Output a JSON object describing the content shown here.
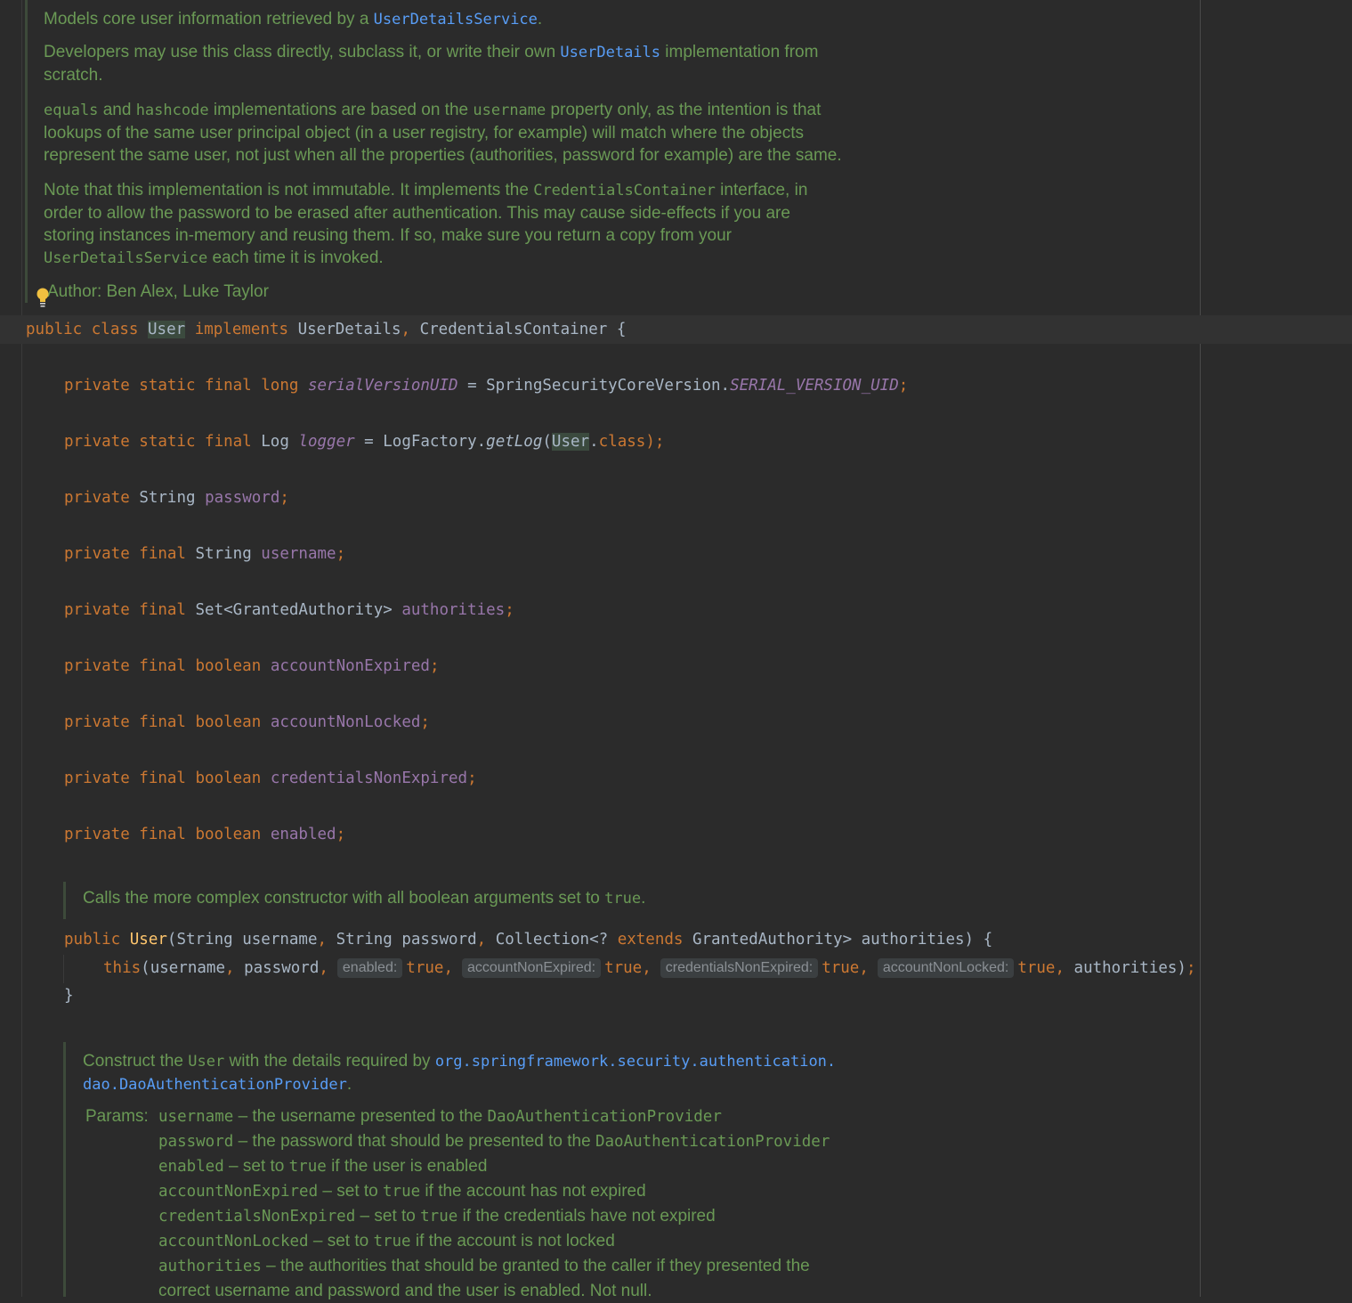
{
  "javadoc_class": {
    "p1_text": "Models core user information retrieved by a ",
    "p1_link": "UserDetailsService",
    "p1_end": ".",
    "p2_a": "Developers may use this class directly, subclass it, or write their own ",
    "p2_link": "UserDetails",
    "p2_b": " implementation from",
    "p2_c": "scratch.",
    "p3_code1": "equals",
    "p3_a": " and ",
    "p3_code2": "hashcode",
    "p3_b": " implementations are based on the ",
    "p3_code3": "username",
    "p3_c": " property only, as the intention is that",
    "p3_line2": "lookups of the same user principal object (in a user registry, for example) will match where the objects",
    "p3_line3": "represent the same user, not just when all the properties (authorities, password for example) are the same.",
    "p4_a": "Note that this implementation is not immutable. It implements the ",
    "p4_code1": "CredentialsContainer",
    "p4_b": " interface, in",
    "p4_line2": "order to allow the password to be erased after authentication. This may cause side-effects if you are",
    "p4_line3": "storing instances in-memory and reusing them. If so, make sure you return a copy from your",
    "p4_code2": "UserDetailsService",
    "p4_c": " each time it is invoked.",
    "author_label": "Author:",
    "author_value": "Ben Alex, Luke Taylor"
  },
  "class_decl": {
    "public": "public",
    "class": "class",
    "name": "User",
    "implements": "implements",
    "iface1": "UserDetails",
    "comma": ",",
    "iface2": "CredentialsContainer",
    "brace": "{"
  },
  "fields": {
    "f1": {
      "mods": "private static final long",
      "name": "serialVersionUID",
      "eq": " = SpringSecurityCoreVersion.",
      "value": "SERIAL_VERSION_UID",
      "semi": ";"
    },
    "f2": {
      "mods": "private static final",
      "type": "Log",
      "name": "logger",
      "eq": " = LogFactory.",
      "call": "getLog",
      "open": "(",
      "arg": "User",
      "dot": ".",
      "cls": "class",
      "close": ");"
    },
    "f3": {
      "mods": "private",
      "type": "String",
      "name": "password",
      "semi": ";"
    },
    "f4": {
      "mods": "private final",
      "type": "String",
      "name": "username",
      "semi": ";"
    },
    "f5": {
      "mods": "private final",
      "type": "Set<GrantedAuthority>",
      "name": "authorities",
      "semi": ";"
    },
    "f6": {
      "mods": "private final boolean",
      "name": "accountNonExpired",
      "semi": ";"
    },
    "f7": {
      "mods": "private final boolean",
      "name": "accountNonLocked",
      "semi": ";"
    },
    "f8": {
      "mods": "private final boolean",
      "name": "credentialsNonExpired",
      "semi": ";"
    },
    "f9": {
      "mods": "private final boolean",
      "name": "enabled",
      "semi": ";"
    }
  },
  "ctor1_doc": {
    "text": "Calls the more complex constructor with all boolean arguments set to ",
    "code": "true",
    "end": "."
  },
  "ctor1": {
    "public": "public",
    "name": "User",
    "p1": "(String username",
    "c1": ",",
    "p2": " String password",
    "c2": ",",
    "p3": " Collection<? ",
    "extends": "extends",
    "p4": " GrantedAuthority> authorities) {",
    "this": "this",
    "a1": "(username",
    "ca": ",",
    "a2": " password",
    "cb": ",",
    "hint1": "enabled:",
    "v1": "true,",
    "hint2": "accountNonExpired:",
    "v2": "true,",
    "hint3": "credentialsNonExpired:",
    "v3": "true,",
    "hint4": "accountNonLocked:",
    "v4": "true,",
    "a3": " authorities)",
    "semi": ";",
    "close": "}"
  },
  "ctor2_doc": {
    "a": "Construct the ",
    "code1": "User",
    "b": " with the details required by ",
    "link1": "org.springframework.security.authentication.",
    "link2": "dao.DaoAuthenticationProvider",
    "end": ".",
    "params_label": "Params:",
    "params": [
      {
        "name": "username",
        "desc": " – the username presented to the ",
        "code": "DaoAuthenticationProvider",
        "rest": ""
      },
      {
        "name": "password",
        "desc": " – the password that should be presented to the ",
        "code": "DaoAuthenticationProvider",
        "rest": ""
      },
      {
        "name": "enabled",
        "desc": " – set to ",
        "code": "true",
        "rest": " if the user is enabled"
      },
      {
        "name": "accountNonExpired",
        "desc": " – set to ",
        "code": "true",
        "rest": " if the account has not expired"
      },
      {
        "name": "credentialsNonExpired",
        "desc": " – set to ",
        "code": "true",
        "rest": " if the credentials have not expired"
      },
      {
        "name": "accountNonLocked",
        "desc": " – set to ",
        "code": "true",
        "rest": " if the account is not locked"
      },
      {
        "name": "authorities",
        "desc": " – the authorities that should be granted to the caller if they presented the",
        "code": "",
        "rest": ""
      }
    ],
    "params_last_line": "correct username and password and the user is enabled. Not null."
  }
}
